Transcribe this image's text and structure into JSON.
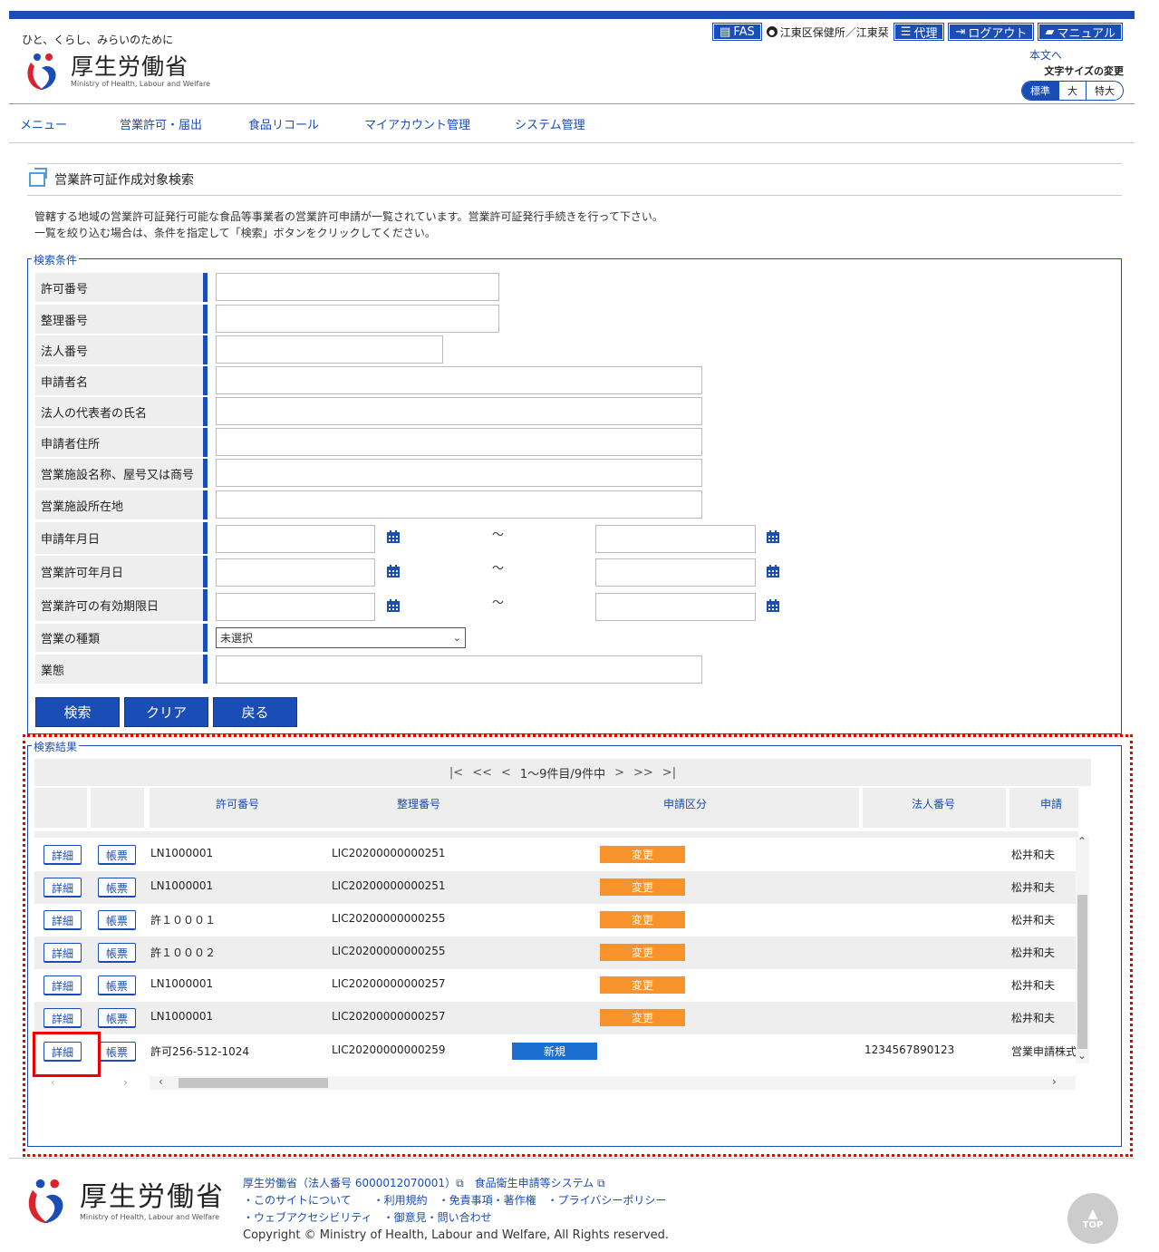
{
  "header": {
    "tagline": "ひと、くらし、みらいのために",
    "logo_jp": "厚生労働省",
    "logo_en": "Ministry of Health, Labour and Welfare",
    "fas_label": "FAS",
    "user_label": "江東区保健所／江東栞",
    "proxy_label": "代理",
    "logout_label": "ログアウト",
    "manual_label": "マニュアル",
    "skip_label": "本文へ",
    "font_size_label": "文字サイズの変更",
    "font_sizes": [
      "標準",
      "大",
      "特大"
    ]
  },
  "nav": [
    "メニュー",
    "営業許可・届出",
    "食品リコール",
    "マイアカウント管理",
    "システム管理"
  ],
  "page": {
    "title": "営業許可証作成対象検索",
    "desc1": "管轄する地域の営業許可証発行可能な食品等事業者の営業許可申請が一覧されています。営業許可証発行手続きを行って下さい。",
    "desc2": "一覧を絞り込む場合は、条件を指定して「検索」ボタンをクリックしてください。"
  },
  "search": {
    "legend": "検索条件",
    "labels": {
      "permit_no": "許可番号",
      "ref_no": "整理番号",
      "corp_no": "法人番号",
      "applicant": "申請者名",
      "rep_name": "法人の代表者の氏名",
      "address": "申請者住所",
      "facility": "営業施設名称、屋号又は商号",
      "facility_addr": "営業施設所在地",
      "apply_date": "申請年月日",
      "permit_date": "営業許可年月日",
      "expiry": "営業許可の有効期限日",
      "biz_type": "営業の種類",
      "biz_form": "業態"
    },
    "tilde": "～",
    "biz_type_value": "未選択",
    "buttons": {
      "search": "検索",
      "clear": "クリア",
      "back": "戻る"
    }
  },
  "results": {
    "legend": "検索結果",
    "pager": {
      "first": "|<",
      "prev2": "<<",
      "prev": "<",
      "info": "1～9件目/9件中",
      "next": ">",
      "next2": ">>",
      "last": ">|"
    },
    "columns": {
      "permit_no": "許可番号",
      "ref_no": "整理番号",
      "category": "申請区分",
      "corp_no": "法人番号",
      "applicant": "申請"
    },
    "detail_label": "詳細",
    "form_label": "帳票",
    "rows": [
      {
        "permit_no": "LN1000001",
        "ref_no": "LIC20200000000251",
        "category": "変更",
        "corp_no": "",
        "applicant": "松井和夫"
      },
      {
        "permit_no": "LN1000001",
        "ref_no": "LIC20200000000251",
        "category": "変更",
        "corp_no": "",
        "applicant": "松井和夫"
      },
      {
        "permit_no": "許１０００１",
        "ref_no": "LIC20200000000255",
        "category": "変更",
        "corp_no": "",
        "applicant": "松井和夫"
      },
      {
        "permit_no": "許１０００２",
        "ref_no": "LIC20200000000255",
        "category": "変更",
        "corp_no": "",
        "applicant": "松井和夫"
      },
      {
        "permit_no": "LN1000001",
        "ref_no": "LIC20200000000257",
        "category": "変更",
        "corp_no": "",
        "applicant": "松井和夫"
      },
      {
        "permit_no": "LN1000001",
        "ref_no": "LIC20200000000257",
        "category": "変更",
        "corp_no": "",
        "applicant": "松井和夫"
      },
      {
        "permit_no": "許可256-512-1024",
        "ref_no": "LIC20200000000259",
        "category": "新規",
        "corp_no": "1234567890123",
        "applicant": "営業申請株式"
      }
    ]
  },
  "footer": {
    "logo_jp": "厚生労働省",
    "logo_en": "Ministry of Health, Labour and Welfare",
    "line1": "厚生労働省（法人番号 6000012070001）⧉　食品衛生申請等システム ⧉",
    "line2": "・このサイトについて　　・利用規約　・免責事項・著作権　・プライバシーポリシー",
    "line3": "・ウェブアクセシビリティ　・御意見・問い合わせ",
    "copyright": "Copyright © Ministry of Health, Labour and Welfare, All Rights reserved.",
    "top_label": "TOP"
  },
  "colors": {
    "brand_blue": "#1a4db5",
    "change_orange": "#f7932a",
    "new_blue": "#1a6fd1",
    "highlight_red": "#ee0000"
  }
}
